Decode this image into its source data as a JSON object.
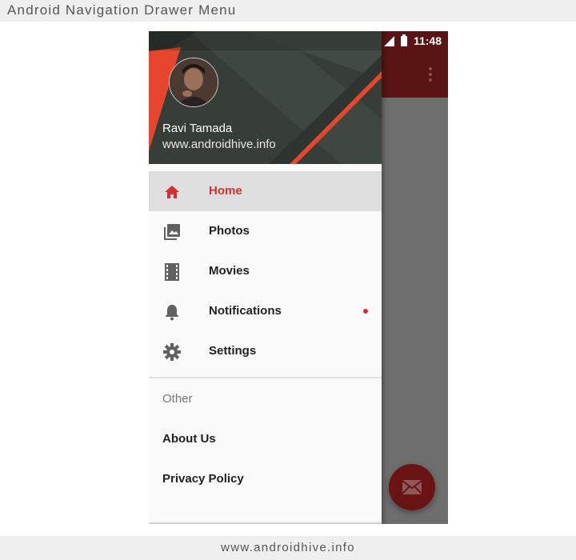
{
  "page": {
    "top_caption": "Android Navigation Drawer Menu",
    "bottom_caption": "www.androidhive.info"
  },
  "status_bar": {
    "time": "11:48"
  },
  "drawer": {
    "header": {
      "name": "Ravi Tamada",
      "website": "www.androidhive.info"
    },
    "items": [
      {
        "label": "Home",
        "icon": "home-icon",
        "active": true
      },
      {
        "label": "Photos",
        "icon": "photos-icon",
        "active": false
      },
      {
        "label": "Movies",
        "icon": "movies-icon",
        "active": false
      },
      {
        "label": "Notifications",
        "icon": "bell-icon",
        "active": false,
        "badge_dot": true
      },
      {
        "label": "Settings",
        "icon": "gear-icon",
        "active": false
      }
    ],
    "section_title": "Other",
    "extra_items": [
      {
        "label": "About Us"
      },
      {
        "label": "Privacy Policy"
      }
    ]
  },
  "colors": {
    "accent": "#d32f2f",
    "header_bg": "#373e38",
    "toolbar_dimmed": "#5a1414",
    "fab_dimmed": "#6a1313"
  }
}
